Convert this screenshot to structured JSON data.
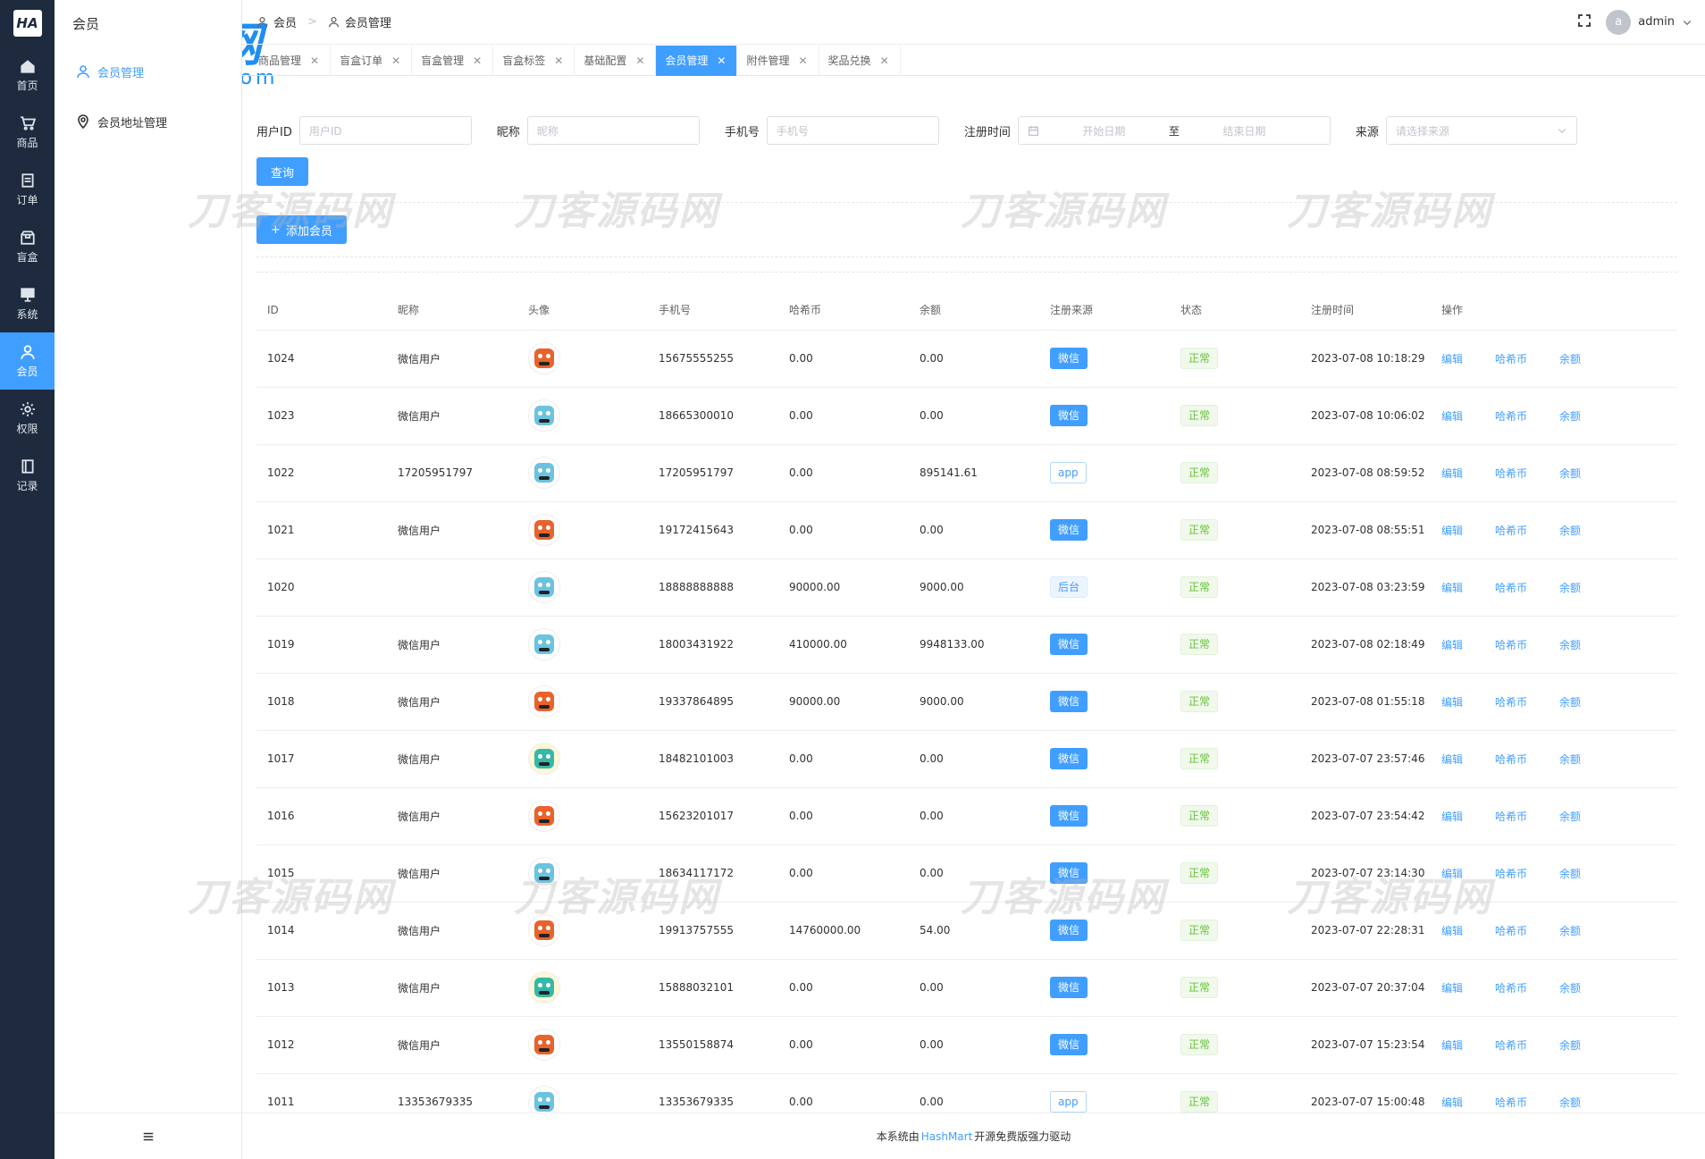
{
  "rail": {
    "logo": "HA",
    "items": [
      {
        "label": "首页",
        "icon": "home-icon"
      },
      {
        "label": "商品",
        "icon": "cart-icon"
      },
      {
        "label": "订单",
        "icon": "order-icon"
      },
      {
        "label": "盲盒",
        "icon": "box-icon"
      },
      {
        "label": "系统",
        "icon": "monitor-icon"
      },
      {
        "label": "会员",
        "icon": "user-icon",
        "active": true
      },
      {
        "label": "权限",
        "icon": "gear-icon"
      },
      {
        "label": "记录",
        "icon": "book-icon"
      }
    ]
  },
  "subside": {
    "title": "会员",
    "items": [
      {
        "label": "会员管理",
        "active": true
      },
      {
        "label": "会员地址管理"
      }
    ]
  },
  "breadcrumb": [
    "会员",
    "会员管理"
  ],
  "user": {
    "avatar": "a",
    "name": "admin"
  },
  "tabs": [
    "商品管理",
    "盲盒订单",
    "盲盒管理",
    "盲盒标签",
    "基础配置",
    "会员管理",
    "附件管理",
    "奖品兑换"
  ],
  "active_tab": "会员管理",
  "filters": {
    "user_id_label": "用户ID",
    "user_id_placeholder": "用户ID",
    "nickname_label": "昵称",
    "nickname_placeholder": "昵称",
    "phone_label": "手机号",
    "phone_placeholder": "手机号",
    "reg_time_label": "注册时间",
    "start_placeholder": "开始日期",
    "range_sep": "至",
    "end_placeholder": "结束日期",
    "source_label": "来源",
    "source_placeholder": "请选择来源"
  },
  "query_button": "查询",
  "add_button": "添加会员",
  "table": {
    "headers": [
      "ID",
      "昵称",
      "头像",
      "手机号",
      "哈希币",
      "余额",
      "注册来源",
      "状态",
      "注册时间",
      "操作"
    ],
    "actions": [
      "编辑",
      "哈希币",
      "余额"
    ],
    "rows": [
      {
        "id": "1024",
        "nick": "微信用户",
        "avatar": "orange",
        "phone": "15675555255",
        "coin": "0.00",
        "balance": "0.00",
        "source": "微信",
        "status": "正常",
        "time": "2023-07-08 10:18:29"
      },
      {
        "id": "1023",
        "nick": "微信用户",
        "avatar": "blue",
        "phone": "18665300010",
        "coin": "0.00",
        "balance": "0.00",
        "source": "微信",
        "status": "正常",
        "time": "2023-07-08 10:06:02"
      },
      {
        "id": "1022",
        "nick": "17205951797",
        "avatar": "blue",
        "phone": "17205951797",
        "coin": "0.00",
        "balance": "895141.61",
        "source": "app",
        "status": "正常",
        "time": "2023-07-08 08:59:52"
      },
      {
        "id": "1021",
        "nick": "微信用户",
        "avatar": "orange",
        "phone": "19172415643",
        "coin": "0.00",
        "balance": "0.00",
        "source": "微信",
        "status": "正常",
        "time": "2023-07-08 08:55:51"
      },
      {
        "id": "1020",
        "nick": "",
        "avatar": "blue",
        "phone": "18888888888",
        "coin": "90000.00",
        "balance": "9000.00",
        "source": "后台",
        "status": "正常",
        "time": "2023-07-08 03:23:59"
      },
      {
        "id": "1019",
        "nick": "微信用户",
        "avatar": "blue",
        "phone": "18003431922",
        "coin": "410000.00",
        "balance": "9948133.00",
        "source": "微信",
        "status": "正常",
        "time": "2023-07-08 02:18:49"
      },
      {
        "id": "1018",
        "nick": "微信用户",
        "avatar": "orange",
        "phone": "19337864895",
        "coin": "90000.00",
        "balance": "9000.00",
        "source": "微信",
        "status": "正常",
        "time": "2023-07-08 01:55:18"
      },
      {
        "id": "1017",
        "nick": "微信用户",
        "avatar": "teal",
        "phone": "18482101003",
        "coin": "0.00",
        "balance": "0.00",
        "source": "微信",
        "status": "正常",
        "time": "2023-07-07 23:57:46"
      },
      {
        "id": "1016",
        "nick": "微信用户",
        "avatar": "orange",
        "phone": "15623201017",
        "coin": "0.00",
        "balance": "0.00",
        "source": "微信",
        "status": "正常",
        "time": "2023-07-07 23:54:42"
      },
      {
        "id": "1015",
        "nick": "微信用户",
        "avatar": "blue",
        "phone": "18634117172",
        "coin": "0.00",
        "balance": "0.00",
        "source": "微信",
        "status": "正常",
        "time": "2023-07-07 23:14:30"
      },
      {
        "id": "1014",
        "nick": "微信用户",
        "avatar": "orange",
        "phone": "19913757555",
        "coin": "14760000.00",
        "balance": "54.00",
        "source": "微信",
        "status": "正常",
        "time": "2023-07-07 22:28:31"
      },
      {
        "id": "1013",
        "nick": "微信用户",
        "avatar": "teal",
        "phone": "15888032101",
        "coin": "0.00",
        "balance": "0.00",
        "source": "微信",
        "status": "正常",
        "time": "2023-07-07 20:37:04"
      },
      {
        "id": "1012",
        "nick": "微信用户",
        "avatar": "orange",
        "phone": "13550158874",
        "coin": "0.00",
        "balance": "0.00",
        "source": "微信",
        "status": "正常",
        "time": "2023-07-07 15:23:54"
      },
      {
        "id": "1011",
        "nick": "13353679335",
        "avatar": "blue",
        "phone": "13353679335",
        "coin": "0.00",
        "balance": "0.00",
        "source": "app",
        "status": "正常",
        "time": "2023-07-07 15:00:48"
      }
    ]
  },
  "footer": {
    "prefix": "本系统由",
    "link": "HashMart",
    "suffix": "开源免费版强力驱动"
  },
  "watermarks": {
    "brand_big": "IT资源网",
    "brand_small": "ITBaiDu.com",
    "tile": "刀客源码网"
  },
  "colors": {
    "primary": "#409eff",
    "rail_bg": "#1e2a3e",
    "success": "#67c23a"
  }
}
